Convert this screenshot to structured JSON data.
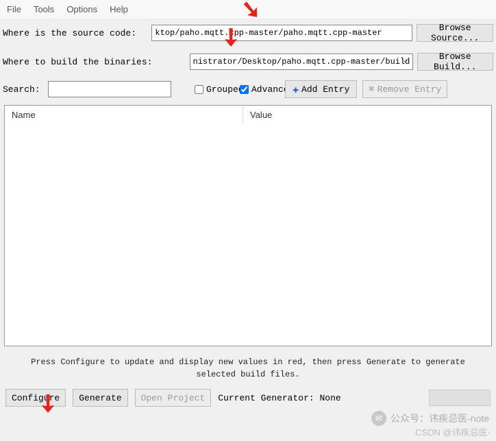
{
  "menu": {
    "file": "File",
    "tools": "Tools",
    "options": "Options",
    "help": "Help"
  },
  "labels": {
    "source": "Where is the source code:",
    "build": "Where to build the binaries:",
    "search": "Search:",
    "grouped": "Grouped",
    "advanced": "Advanced",
    "current_generator": "Current Generator: None"
  },
  "inputs": {
    "source_value": "ktop/paho.mqtt.cpp-master/paho.mqtt.cpp-master",
    "build_value": "nistrator/Desktop/paho.mqtt.cpp-master/build",
    "search_value": ""
  },
  "buttons": {
    "browse_source": "Browse Source...",
    "browse_build": "Browse Build...",
    "add_entry": "Add Entry",
    "remove_entry": "Remove Entry",
    "configure": "Configure",
    "generate": "Generate",
    "open_project": "Open Project"
  },
  "checkboxes": {
    "grouped": false,
    "advanced": true
  },
  "table": {
    "headers": {
      "name": "Name",
      "value": "Value"
    },
    "rows": []
  },
  "hint": "Press Configure to update and display new values in red, then press Generate to generate selected build files.",
  "watermark": {
    "line1": "公众号：讳疾忌医-note",
    "line2": "CSDN @讳疾忌医·"
  }
}
